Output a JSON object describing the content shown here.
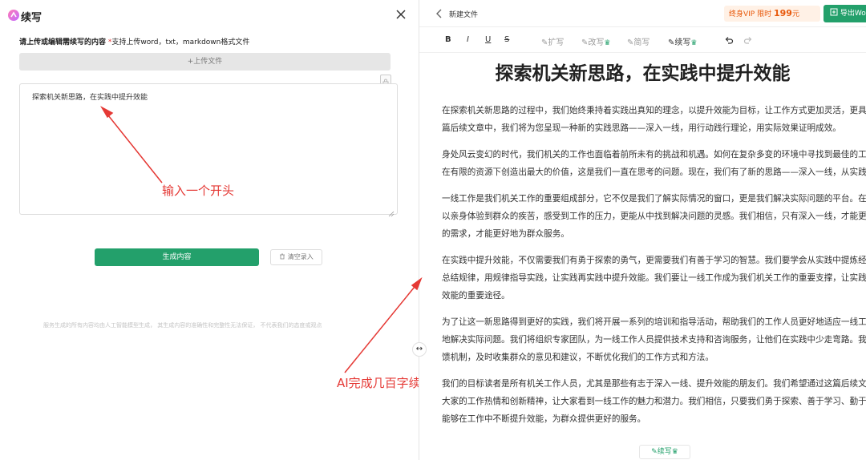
{
  "left_panel": {
    "title": "续写",
    "label_bold": "请上传或编辑需续写的内容",
    "label_required": "*",
    "label_hint": "支持上传word，txt，markdown格式文件",
    "upload_label": "+上传文件",
    "editor_text": "探索机关新思路，在实践中提升效能",
    "generate_label": "生成内容",
    "clear_label": "清空录入",
    "disclaimer": "服务生成的所有内容均由人工智能模型生成， 其生成内容的准确性和完整性无法保证， 不代表我们的态度或观点"
  },
  "annotations": {
    "input_hint": "输入一个开头",
    "ai_hint": "AI完成几百字续写"
  },
  "right_panel": {
    "doc_name": "新建文件",
    "vip_text": "终身VIP 限时",
    "vip_price": "199",
    "vip_unit": "元",
    "export_label": "导出Wo",
    "toolbar": {
      "bold": "B",
      "italic": "I",
      "underline": "U",
      "strike": "S",
      "expand": "扩写",
      "rewrite": "改写",
      "shorten": "简写",
      "continue": "续写",
      "crown": "♛"
    },
    "doc_title": "探索机关新思路，在实践中提升效能",
    "paragraphs": [
      "在探索机关新思路的过程中，我们始终秉持着实践出真知的理念，以提升效能为目标，让工作方式更加灵活，更具创造性。在这篇后续文章中，我们将为您呈现一种新的实践思路——深入一线，用行动践行理论，用实际效果证明成效。",
      "身处风云变幻的时代，我们机关的工作也面临着前所未有的挑战和机遇。如何在复杂多变的环境中寻找到最佳的工作方式，如何在有限的资源下创造出最大的价值，这是我们一直在思考的问题。现在，我们有了新的思路——深入一线，从实践中提升效能。",
      "一线工作是我们机关工作的重要组成部分，它不仅是我们了解实际情况的窗口，更是我们解决实际问题的平台。在这里，我们可以亲身体验到群众的疾苦，感受到工作的压力，更能从中找到解决问题的灵感。我们相信，只有深入一线，才能更好地了解群众的需求，才能更好地为群众服务。",
      "在实践中提升效能，不仅需要我们有勇于探索的勇气，更需要我们有善于学习的智慧。我们要学会从实践中提炼经验，从经验中总结规律，用规律指导实践，让实践再实践中提升效能。我们要让一线工作成为我们机关工作的重要支撑，让实践成为我们提升效能的重要途径。",
      "为了让这一新思路得到更好的实践，我们将开展一系列的培训和指导活动，帮助我们的工作人员更好地适应一线工作环境，更好地解决实际问题。我们将组织专家团队，为一线工作人员提供技术支持和咨询服务，让他们在实践中少走弯路。我们还将建立反馈机制，及时收集群众的意见和建议，不断优化我们的工作方式和方法。",
      "我们的目标读者是所有机关工作人员，尤其是那些有志于深入一线、提升效能的朋友们。我们希望通过这篇后续文章，能够激发大家的工作热情和创新精神，让大家看到一线工作的魅力和潜力。我们相信，只要我们勇于探索、善于学习、勤于实践，就一定能够在工作中不断提升效能，为群众提供更好的服务。"
    ],
    "bottom_float": "续写"
  },
  "colors": {
    "brand_green": "#23a06b",
    "annotation_red": "#e53935",
    "vip_orange": "#e8590c"
  },
  "icons": [
    "logo-icon",
    "close-icon",
    "lock-icon",
    "resize-grip-icon",
    "trash-icon",
    "back-icon",
    "export-icon",
    "undo-icon",
    "redo-icon",
    "drag-handle-icon"
  ]
}
